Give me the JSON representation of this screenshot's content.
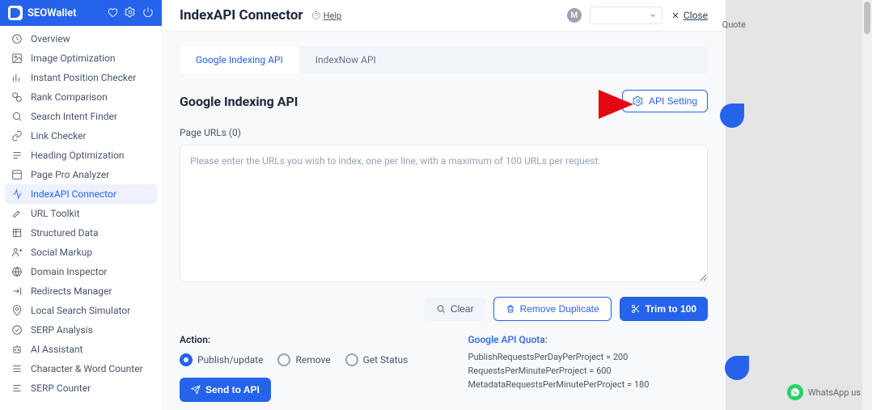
{
  "brand": "SEOWallet",
  "sidebar": {
    "items": [
      {
        "label": "Overview"
      },
      {
        "label": "Image Optimization"
      },
      {
        "label": "Instant Position Checker"
      },
      {
        "label": "Rank Comparison"
      },
      {
        "label": "Search Intent Finder"
      },
      {
        "label": "Link Checker"
      },
      {
        "label": "Heading Optimization"
      },
      {
        "label": "Page Pro Analyzer"
      },
      {
        "label": "IndexAPI Connector"
      },
      {
        "label": "URL Toolkit"
      },
      {
        "label": "Structured Data"
      },
      {
        "label": "Social Markup"
      },
      {
        "label": "Domain Inspector"
      },
      {
        "label": "Redirects Manager"
      },
      {
        "label": "Local Search Simulator"
      },
      {
        "label": "SERP Analysis"
      },
      {
        "label": "AI Assistant"
      },
      {
        "label": "Character & Word Counter"
      },
      {
        "label": "SERP Counter"
      }
    ]
  },
  "header": {
    "title": "IndexAPI Connector",
    "help": "Help",
    "avatar_letter": "M",
    "close": "Close"
  },
  "tabs": {
    "google": "Google Indexing API",
    "indexnow": "IndexNow API"
  },
  "panel": {
    "title": "Google Indexing API",
    "api_setting": "API Setting",
    "urls_label": "Page URLs (0)",
    "placeholder": "Please enter the URLs you wish to index, one per line, with a maximum of 100 URLs per request."
  },
  "buttons": {
    "clear": "Clear",
    "remove_dup": "Remove Duplicate",
    "trim": "Trim to 100",
    "send": "Send to API"
  },
  "action": {
    "label": "Action:",
    "publish": "Publish/update",
    "remove": "Remove",
    "get_status": "Get Status"
  },
  "quota": {
    "title": "Google API Quota:",
    "line1": "PublishRequestsPerDayPerProject = 200",
    "line2": "RequestsPerMinutePerProject = 600",
    "line3": "MetadataRequestsPerMinutePerProject = 180"
  },
  "bg": {
    "quote": "Quote",
    "whatsapp": "WhatsApp us"
  }
}
